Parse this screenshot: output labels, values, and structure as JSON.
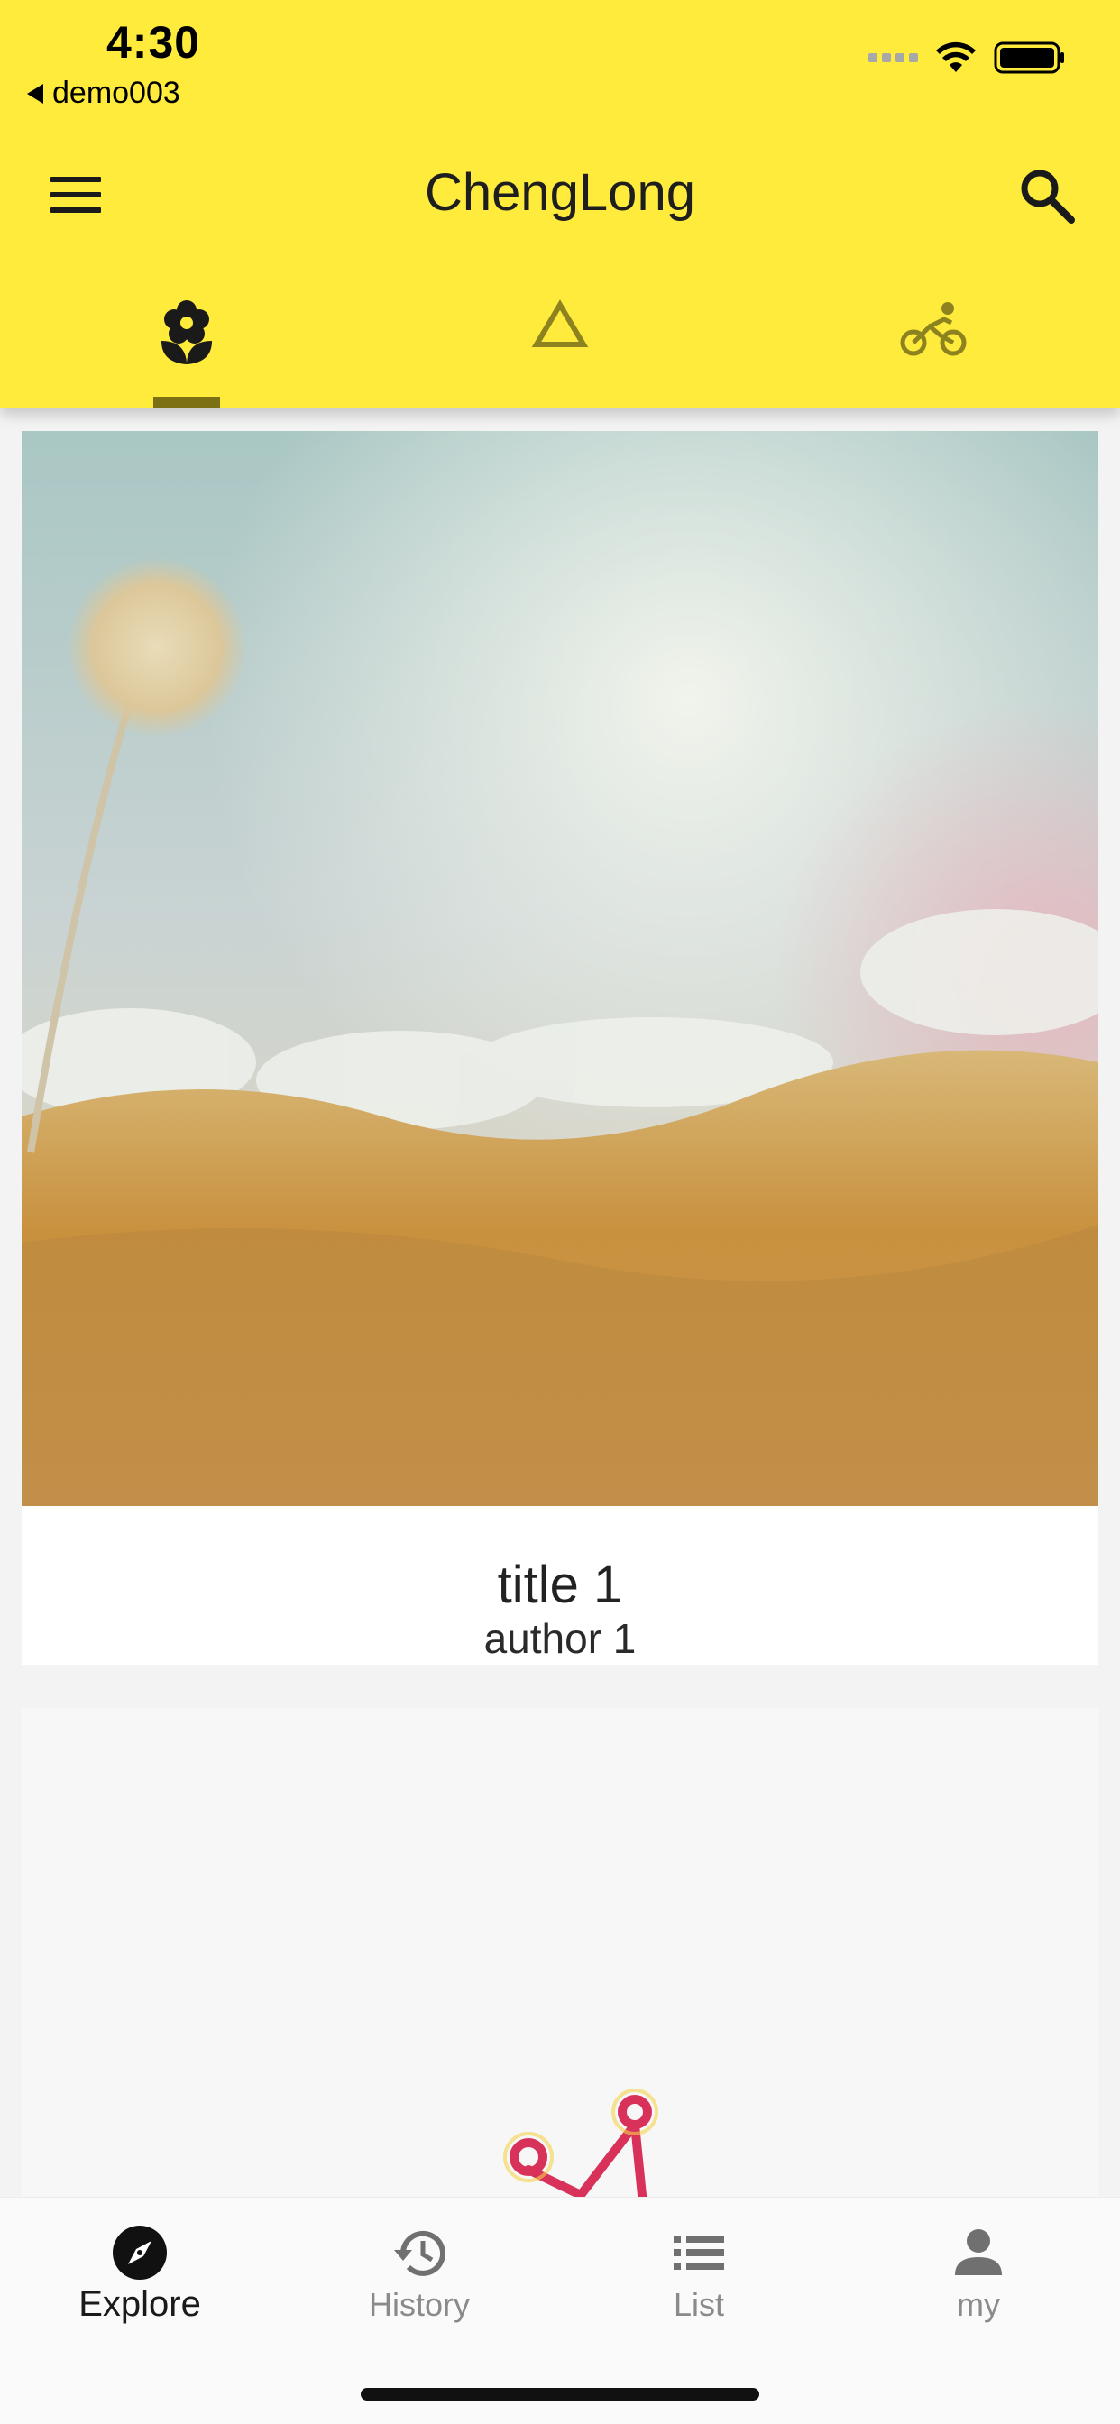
{
  "status_bar": {
    "time": "4:30",
    "back_app": "demo003",
    "icons": [
      "signal-dots-icon",
      "wifi-icon",
      "battery-icon"
    ]
  },
  "app_bar": {
    "title": "ChengLong",
    "menu_icon": "menu-icon",
    "search_icon": "search-icon",
    "background_color": "#ffeb3b"
  },
  "tabs": [
    {
      "icon": "flower-icon",
      "selected": true
    },
    {
      "icon": "triangle-icon",
      "selected": false
    },
    {
      "icon": "bike-icon",
      "selected": false
    }
  ],
  "cards": [
    {
      "title": "title 1",
      "author": "author 1",
      "image": "dandelion-meadow-photo"
    },
    {
      "title": "",
      "author": "",
      "image": "crown-doodle-photo"
    }
  ],
  "bottom_nav": {
    "items": [
      {
        "label": "Explore",
        "icon": "compass-icon",
        "active": true
      },
      {
        "label": "History",
        "icon": "history-icon",
        "active": false
      },
      {
        "label": "List",
        "icon": "list-icon",
        "active": false
      },
      {
        "label": "my",
        "icon": "person-icon",
        "active": false
      }
    ]
  }
}
